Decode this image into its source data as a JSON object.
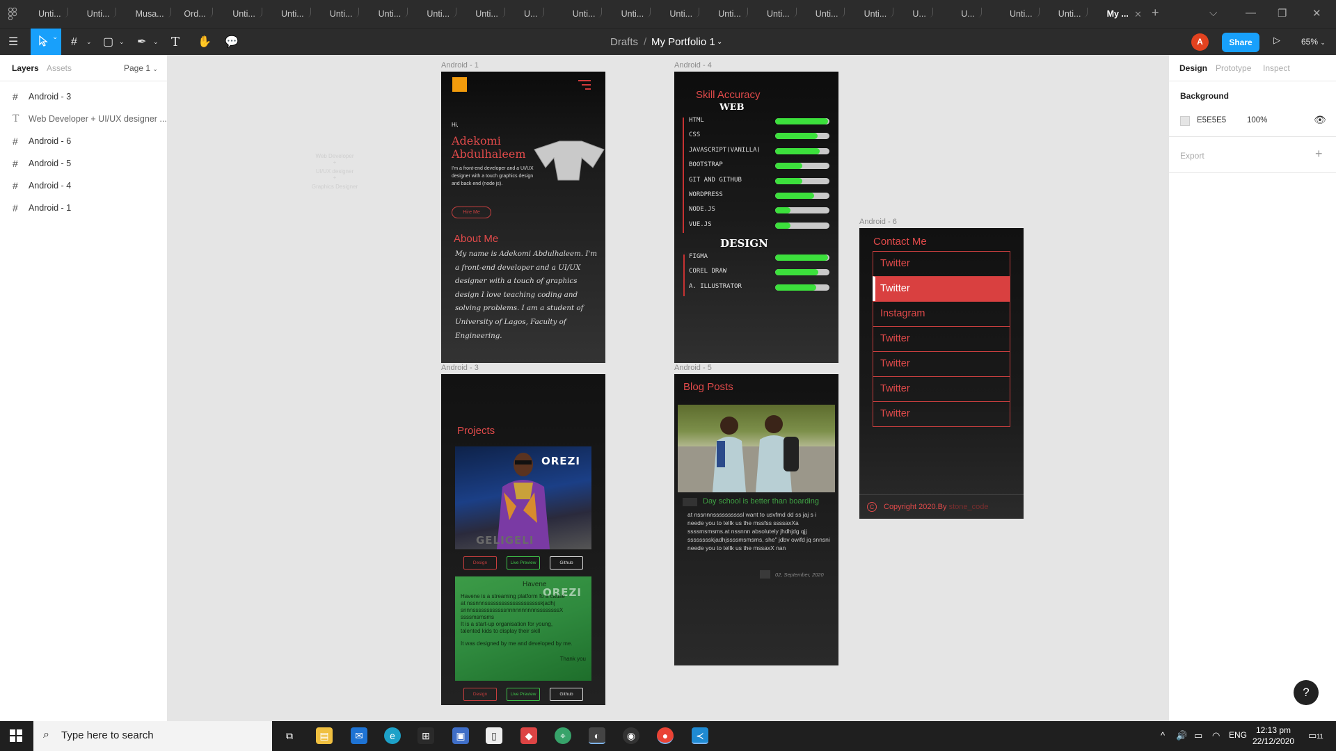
{
  "browser": {
    "tabs": [
      "Unti...",
      "Unti...",
      "Musa...",
      "Ord...",
      "Unti...",
      "Unti...",
      "Unti...",
      "Unti...",
      "Unti...",
      "Unti...",
      "U...",
      "Unti...",
      "Unti...",
      "Unti...",
      "Unti...",
      "Unti...",
      "Unti...",
      "Unti...",
      "U...",
      "U...",
      "Unti...",
      "Unti...",
      "My ..."
    ],
    "active_tab": "My ..."
  },
  "toolbar": {
    "breadcrumb_root": "Drafts",
    "breadcrumb_sep": "/",
    "file_name": "My Portfolio 1",
    "avatar_initial": "A",
    "share_label": "Share",
    "zoom": "65%",
    "accent": "#18a0fb"
  },
  "left_panel": {
    "tab_layers": "Layers",
    "tab_assets": "Assets",
    "page_selector": "Page 1",
    "layers": [
      {
        "icon": "frame-icon",
        "name": "Android - 3"
      },
      {
        "icon": "text-icon",
        "name": "Web Developer + UI/UX designer ..."
      },
      {
        "icon": "frame-icon",
        "name": "Android - 6"
      },
      {
        "icon": "frame-icon",
        "name": "Android - 5"
      },
      {
        "icon": "frame-icon",
        "name": "Android - 4"
      },
      {
        "icon": "frame-icon",
        "name": "Android - 1"
      }
    ]
  },
  "right_panel": {
    "tab_design": "Design",
    "tab_prototype": "Prototype",
    "tab_inspect": "Inspect",
    "background_label": "Background",
    "bg_hex": "E5E5E5",
    "bg_opacity": "100%",
    "export_label": "Export",
    "help_label": "?"
  },
  "canvas": {
    "ghost_text": [
      "Web Developer",
      "+",
      "UI/UX designer",
      "+",
      "Graphics Designer"
    ],
    "frame_labels": {
      "a1": "Android - 1",
      "a3": "Android - 3",
      "a4": "Android - 4",
      "a5": "Android - 5",
      "a6": "Android - 6"
    },
    "android1": {
      "greeting": "Hi,",
      "name_line1": "Adekomi",
      "name_line2": "Abdulhaleem",
      "description": "I'm a front-end developer and a UI/UX designer with a touch graphics design and back end (node js).",
      "hire_button": "Hire Me",
      "about_heading": "About Me",
      "about_text": "My name is Adekomi Abdulhaleem. I'm a front-end developer and a UI/UX designer with a touch of graphics design I love teaching coding and solving problems. I am a student of University of Lagos, Faculty of Engineering."
    },
    "android3": {
      "heading": "Projects",
      "brand_word": "OREZI",
      "brand_word2": "GELIGELI",
      "buttons": [
        "Design",
        "Live Preview",
        "Github"
      ],
      "project2_title": "Havene",
      "project2_body": [
        "Havene is a streaming platform fo a cause",
        "at nssnnnsssssssssssssssssssskjadhj",
        "snnnssssssssssssnnnnnnnnnnssssssssX",
        "ssssmsmsms",
        "It is a start-up organisation for young,",
        "talented kids to display their skill",
        "",
        "It was designed by me and developed by me.",
        "Thank you"
      ]
    },
    "android4": {
      "heading": "Skill Accuracy",
      "web_heading": "WEB",
      "design_heading": "DESIGN",
      "web_skills": [
        {
          "name": "HTML",
          "level": 0.97
        },
        {
          "name": "CSS",
          "level": 0.78
        },
        {
          "name": "JAVASCRIPT(VANILLA)",
          "level": 0.82
        },
        {
          "name": "BOOTSTRAP",
          "level": 0.5
        },
        {
          "name": "GIT AND GITHUB",
          "level": 0.5
        },
        {
          "name": "WORDPRESS",
          "level": 0.72
        },
        {
          "name": "NODE.JS",
          "level": 0.28
        },
        {
          "name": "VUE.JS",
          "level": 0.28
        }
      ],
      "design_skills": [
        {
          "name": "FIGMA",
          "level": 0.97
        },
        {
          "name": "COREL DRAW",
          "level": 0.8
        },
        {
          "name": "A. ILLUSTRATOR",
          "level": 0.75
        }
      ]
    },
    "android5": {
      "heading": "Blog Posts",
      "post_title": "Day school is better than boarding",
      "post_body": "at nssnnnssssssssssl want to usvfmd dd ss jaj s i neede you to tellk us the mssfss ssssaxXa ssssmsmsms.at nssnnn absolutely jhdhjdg qjj sssssssskjadhjssssmsmsms, she\" jdbv owifd jq snnsni neede you to tellk us the mssaxX nan",
      "post_date": "02, September, 2020"
    },
    "android6": {
      "heading": "Contact Me",
      "items": [
        "Twitter",
        "Twitter",
        "Instagram",
        "Twitter",
        "Twitter",
        "Twitter",
        "Twitter"
      ],
      "selected_index": 1,
      "copyright_symbol": "C",
      "copyright": "Copyright 2020.By",
      "copyright_author": "stone_code"
    }
  },
  "taskbar": {
    "search_placeholder": "Type here to search",
    "language": "ENG",
    "time": "12:13 pm",
    "date": "22/12/2020",
    "notification_count": "11"
  }
}
